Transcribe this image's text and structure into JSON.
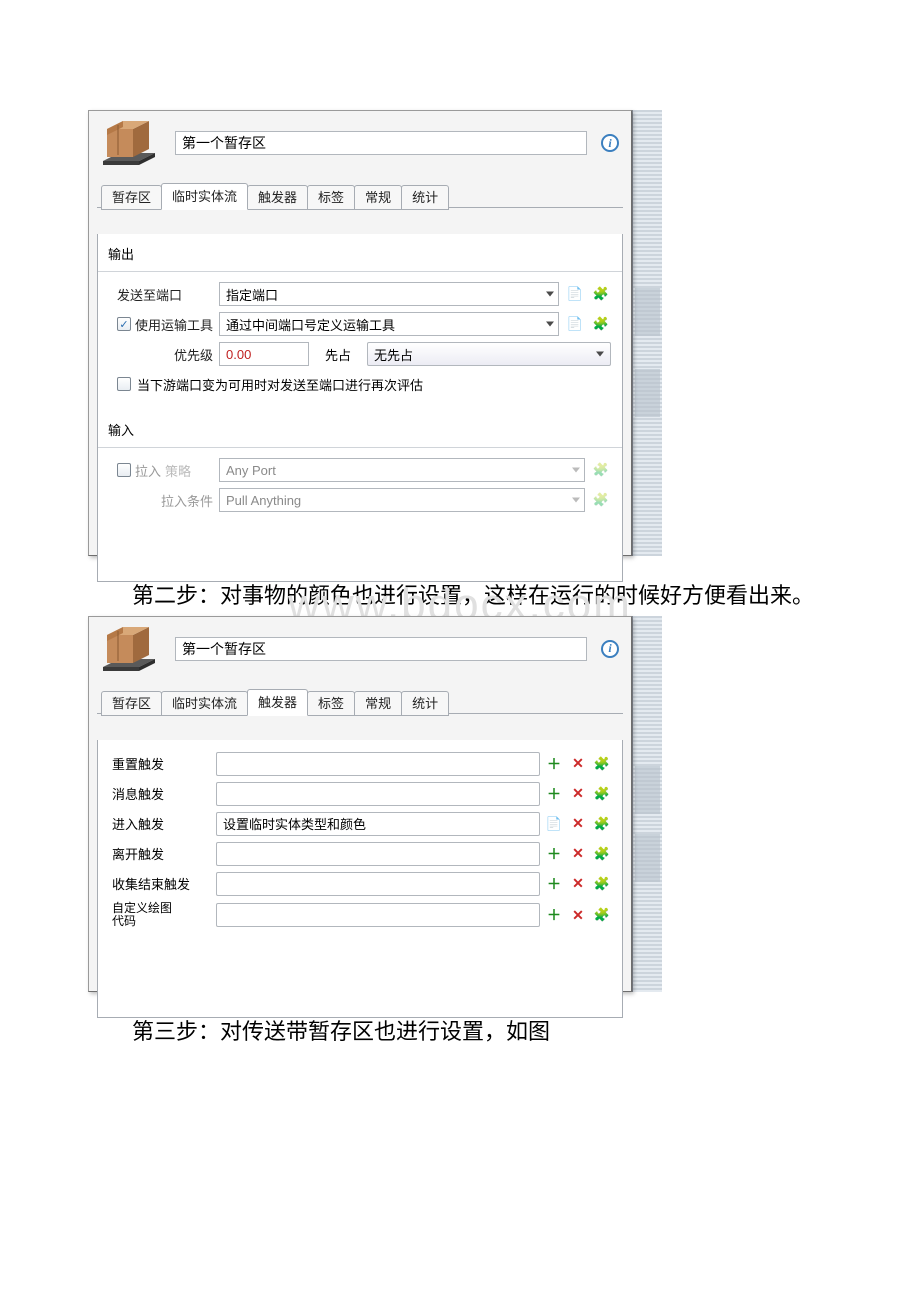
{
  "captions": {
    "step2": "第二步：对事物的颜色也进行设置，这样在运行的时候好方便看出来。",
    "step3": "第三步：对传送带暂存区也进行设置，如图"
  },
  "watermark": "www.bdocx.com",
  "panel1": {
    "title": "第一个暂存区",
    "tabs": [
      "暂存区",
      "临时实体流",
      "触发器",
      "标签",
      "常规",
      "统计"
    ],
    "active_tab": "临时实体流",
    "output_label": "输出",
    "rows": {
      "send_to_port": {
        "label": "发送至端口",
        "value": "指定端口"
      },
      "use_transport": {
        "label": "使用运输工具",
        "value": "通过中间端口号定义运输工具",
        "checked": true
      },
      "priority": {
        "label": "优先级",
        "value": "0.00",
        "pre_label": "先占",
        "select": "无先占"
      },
      "reeval": {
        "label": "当下游端口变为可用时对发送至端口进行再次评估",
        "checked": false
      }
    },
    "input_label": "输入",
    "pull": {
      "strategy_label_a": "拉入",
      "strategy_label_b": "策略",
      "strategy_value": "Any Port",
      "cond_label": "拉入条件",
      "cond_value": "Pull Anything"
    }
  },
  "panel2": {
    "title": "第一个暂存区",
    "tabs": [
      "暂存区",
      "临时实体流",
      "触发器",
      "标签",
      "常规",
      "统计"
    ],
    "active_tab": "触发器",
    "rows": {
      "reset": {
        "label": "重置触发",
        "value": ""
      },
      "message": {
        "label": "消息触发",
        "value": ""
      },
      "enter": {
        "label": "进入触发",
        "value": "设置临时实体类型和颜色"
      },
      "exit": {
        "label": "离开触发",
        "value": ""
      },
      "collect": {
        "label": "收集结束触发",
        "value": ""
      },
      "draw": {
        "label_a": "自定义绘图",
        "label_b": "代码",
        "value": ""
      }
    }
  }
}
